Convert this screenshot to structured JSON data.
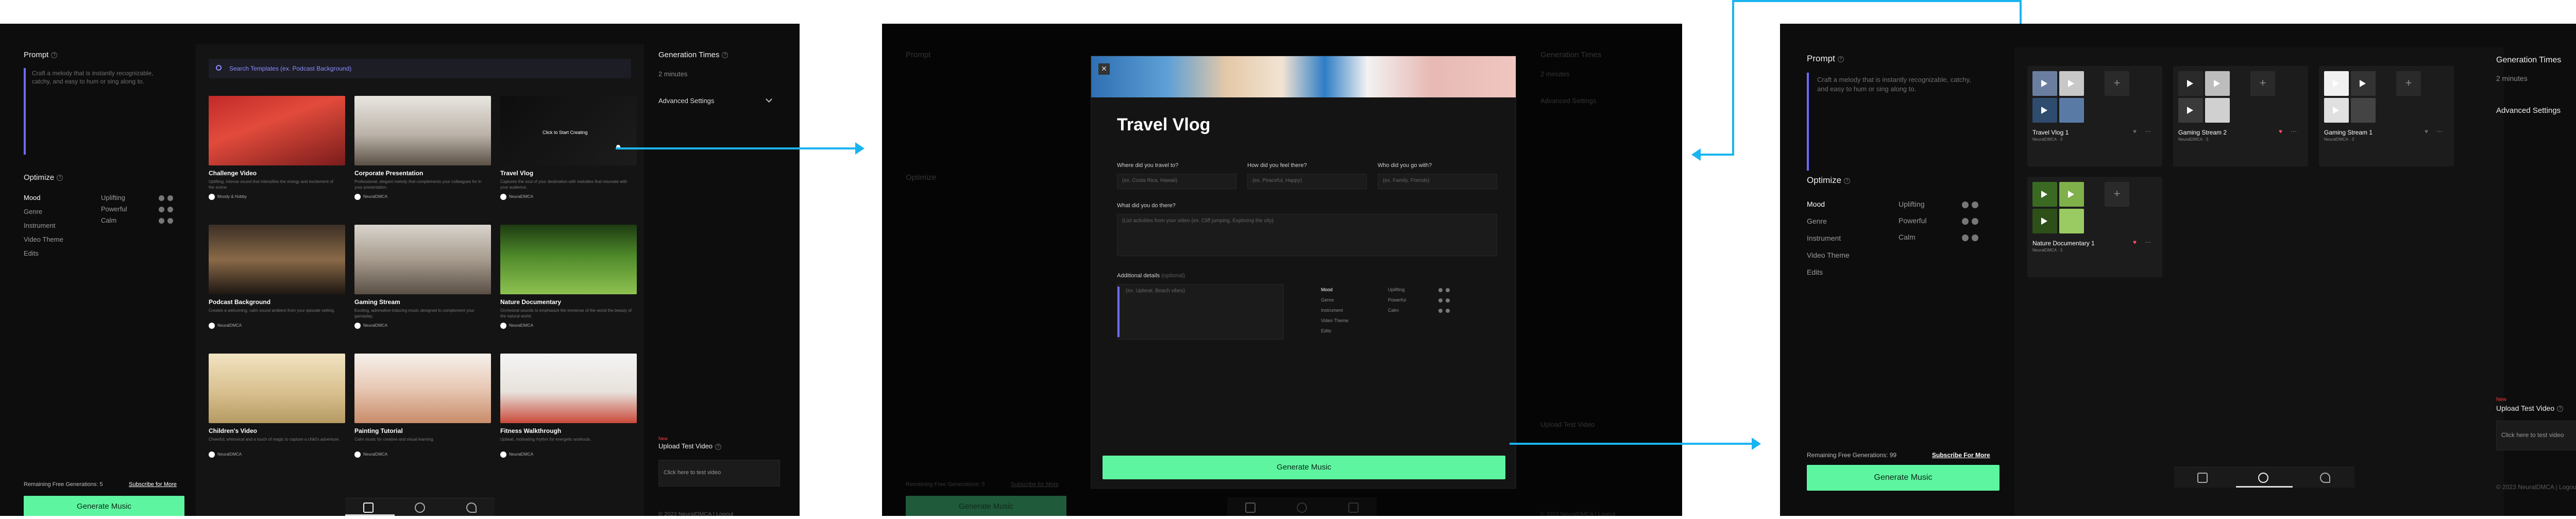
{
  "colors": {
    "accent": "#6c6cff",
    "primary": "#5ef5a0",
    "arrow": "#19b5f0",
    "heart": "#ff4d6d",
    "new_badge": "#ff3a3a"
  },
  "left": {
    "prompt_label": "Prompt",
    "prompt_placeholder": "Craft a melody that is instantly recognizable, catchy, and easy to hum or sing along to.",
    "optimize_label": "Optimize",
    "categories": [
      "Mood",
      "Genre",
      "Instrument",
      "Video Theme",
      "Edits"
    ],
    "moods": [
      "Uplifting",
      "Powerful",
      "Calm"
    ],
    "remaining": "Remaining Free Generations: 5",
    "remaining_full": "Remaining Free Generations: 99",
    "subscribe": "Subscribe for More",
    "subscribe_caps": "Subscribe For More",
    "generate": "Generate Music"
  },
  "search": {
    "placeholder": "Search Templates (ex. Podcast Background)"
  },
  "templates": [
    {
      "title": "Challenge Video",
      "desc": "Uplifting, intense sound that intensifies the energy and excitement of the scene.",
      "source": "Moody & Hobby"
    },
    {
      "title": "Corporate Presentation",
      "desc": "Professional, elegant melody that complements your colleagues for in your presentation.",
      "source": "NeuralDMCA"
    },
    {
      "title": "Travel Vlog",
      "desc": "Captures the soul of your destination with melodies that resonate with your audience.",
      "source": "NeuralDMCA",
      "hover": "Click to Start Creating"
    },
    {
      "title": "Podcast Background",
      "desc": "Creates a welcoming, calm sound ambient from your episode setting.",
      "source": "NeuralDMCA"
    },
    {
      "title": "Gaming Stream",
      "desc": "Exciting, adrenaline-inducing music designed to complement your gameplay.",
      "source": "NeuralDMCA"
    },
    {
      "title": "Nature Documentary",
      "desc": "Orchestral sounds to emphasize the immense of the world the beauty of the natural world.",
      "source": "NeuralDMCA"
    },
    {
      "title": "Children's Video",
      "desc": "Cheerful, whimsical and a touch of magic to capture a child's adventure.",
      "source": "NeuralDMCA"
    },
    {
      "title": "Painting Tutorial",
      "desc": "Calm music for creative and visual learning.",
      "source": "NeuralDMCA"
    },
    {
      "title": "Fitness Walkthrough",
      "desc": "Upbeat, motivating rhythm for energetic workouts.",
      "source": "NeuralDMCA"
    }
  ],
  "right": {
    "gen_times_label": "Generation Times",
    "gen_times_value": "2 minutes",
    "advanced": "Advanced Settings",
    "new_badge": "New",
    "upload_label": "Upload Test Video",
    "upload_placeholder": "Click here to test video",
    "footer": "© 2023 NeuralDMCA | Logout"
  },
  "modal": {
    "title": "Travel Vlog",
    "q1": "Where did you travel to?",
    "q1_ph": "(ex. Costa Rica, Hawaii)",
    "q2": "How did you feel there?",
    "q2_ph": "(ex. Peaceful, Happy)",
    "q3": "Who did you go with?",
    "q3_ph": "(ex. Family, Friends)",
    "q4": "What did you do there?",
    "q4_ph": "(List activities from your video (ex. Cliff jumping, Exploring the city)",
    "details": "Additional details",
    "details_opt": "(optional)",
    "details_ph": "(ex. Upbeat, Beach vibes)",
    "generate": "Generate Music"
  },
  "generations": [
    {
      "title": "Travel Vlog 1",
      "sub": "NeuralDMCA · 3",
      "liked": false
    },
    {
      "title": "Gaming Stream 2",
      "sub": "NeuralDMCA · 3",
      "liked": true
    },
    {
      "title": "Gaming Stream 1",
      "sub": "NeuralDMCA · 3",
      "liked": false
    },
    {
      "title": "Nature Documentary 1",
      "sub": "NeuralDMCA · 3",
      "liked": true
    }
  ]
}
